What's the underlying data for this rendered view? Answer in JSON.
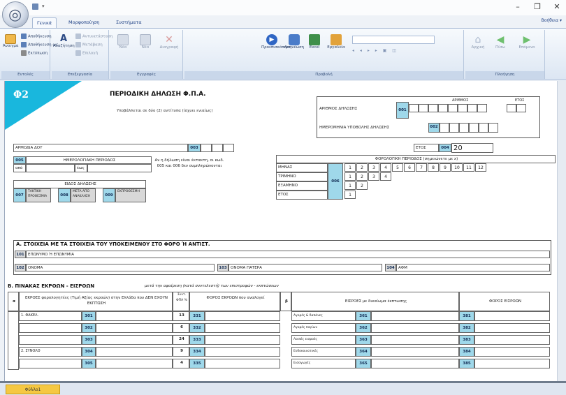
{
  "window": {
    "minimize": "–",
    "maximize": "❐",
    "close": "✕"
  },
  "ribbon_tabs": [
    "Γενικά",
    "Μορφοποίηση",
    "Συστήματα"
  ],
  "help_text": "Βοήθεια ▾",
  "ribbon": {
    "groups": [
      {
        "label": "Εντολές",
        "buttons": [
          "Άνοιγμα"
        ],
        "small": [
          "Αποθήκευση",
          "Αποθήκευση ως",
          "Εκτύπωση"
        ]
      },
      {
        "label": "Επεξεργασία",
        "buttons": [
          "Αναζήτηση"
        ],
        "small": [
          "Αντικατάσταση",
          "Μετάβαση",
          "Επιλογή"
        ]
      },
      {
        "label": "Εγγραφές",
        "buttons": [
          "Νέα",
          "Νέο",
          "Διαγραφή"
        ]
      },
      {
        "label": "Προβολή",
        "buttons": [
          "Προεπισκόπηση",
          "Ανανέωση",
          "Excel",
          "Εργαλεία"
        ]
      },
      {
        "label": "Πλοήγηση",
        "buttons": [
          "Αρχική",
          "Πίσω",
          "Επόμενο"
        ]
      }
    ]
  },
  "form": {
    "symbol": "Φ2",
    "title": "ΠΕΡΙΟΔΙΚΗ ΔΗΛΩΣΗ Φ.Π.Α.",
    "subtitle": "Υποβάλλεται σε δύο (2) αντίτυπα (ίσχυει ενιαίως)",
    "decl_number_label": "ΑΡΙΘΜΟΣ ΔΗΛΩΣΗΣ",
    "code_001": "001",
    "arithmos_hdr": "ΑΡΙΘΜΟΣ",
    "etos_hdr": "ΕΤΟΣ",
    "prev_decl_label": "ΗΜΕΡΟΜΗΝΙΑ ΥΠΟΒΟΛΗΣ ΔΗΛΩΣΗΣ",
    "code_002": "002",
    "doy_label": "ΑΡΜΟΔΙΑ ΔΟΥ",
    "code_003": "003",
    "period_code": "005",
    "period_label": "ΗΜΕΡΟΛΟΓΙΑΚΗ ΠΕΡΙΟΔΟΣ",
    "apo": "από",
    "eos": "έως",
    "note": "Αν η δήλωση είναι έκτακτη, οι κωδ. 005 και 006 δεν συμπληρώνονται",
    "year_label": "ΕΤΟΣ",
    "code_004": "004",
    "year_value": "20",
    "tax_period_label": "ΦΟΡΟΛΟΓΙΚΗ ΠΕΡΙΟΔΟΣ (σημειώνετε με x)",
    "code_006": "006",
    "period_rows": [
      {
        "label": "ΜΗΝΑΣ",
        "nums": [
          "1",
          "2",
          "3",
          "4",
          "5",
          "6",
          "7",
          "8",
          "9",
          "10",
          "11",
          "12"
        ]
      },
      {
        "label": "ΤΡΙΜΗΝΟ",
        "nums": [
          "1",
          "2",
          "3",
          "4"
        ]
      },
      {
        "label": "ΕΞΑΜΗΝΟ",
        "nums": [
          "1",
          "2"
        ]
      },
      {
        "label": "ΕΤΟΣ",
        "nums": [
          "1"
        ]
      }
    ],
    "decl_type_label": "ΕΙΔΟΣ ΔΗΛΩΣΗΣ",
    "decl_types": [
      {
        "code": "007",
        "label": "ΤΑΚΤΙΚΗ ΠΡΟΘΕΣΜΙΑ"
      },
      {
        "code": "008",
        "label": "ΜΕΤΑ ΑΠΟ ΑΝΑΚΛΗΣΗ"
      },
      {
        "code": "009",
        "label": "ΕΚΠΡΟΘΕΣΜΗ"
      }
    ],
    "sectionA": "Α. ΣΤΟΙΧΕΙΑ ΜΕ ΤΑ ΣΤΟΙΧΕΙΑ ΤΟΥ ΥΠΟΚΕΙΜΕΝΟΥ ΣΤΟ ΦΟΡΟ Ή ΑΝΤΙΣΤ.",
    "a_rows": [
      {
        "code": "101",
        "label": "ΕΠΩΝΥΜΟ Ή ΕΠΩΝΥΜΙΑ"
      },
      {
        "code": "102",
        "label": "ΟΝΟΜΑ"
      },
      {
        "code": "103",
        "label": "ΟΝΟΜΑ ΠΑΤΕΡΑ"
      },
      {
        "code": "104",
        "label": "ΑΦΜ"
      }
    ],
    "sectionB": "Β. ΠΙΝΑΚΑΣ ΕΚΡΟΩΝ - ΕΙΣΡΟΩΝ",
    "sectionB_sub": "μετά την αφαίρεση (κατά συντελεστή) των επιστροφών - εκπτώσεων",
    "col_a": "α",
    "col_b": "β",
    "col_a_hdr": "ΕΚΡΟΕΣ φορολογητέες (Τιμή Αξίας εκροών) στην Ελλάδα που ΔΕΝ ΕΧΟΥΝ ΕΚΠΤΩΣΗ",
    "col_rate_hdr": "Συντ. ΦΠΑ %",
    "col_vat_hdr": "ΦΟΡΟΣ ΕΚΡΟΩΝ που αναλογεί",
    "col_b_hdr": "ΕΙΣΡΟΕΣ με δικαίωμα έκπτωσης",
    "col_vat_in_hdr": "ΦΟΡΟΣ ΕΙΣΡΟΩΝ",
    "rows": [
      {
        "left": "1. ΦΑΚΕΛ.",
        "code": "301",
        "rate": "13",
        "vcode": "331",
        "rlabel": "Αγορές & δαπάνες",
        "icode": "361",
        "tcode": "381"
      },
      {
        "left": "",
        "code": "302",
        "rate": "6",
        "vcode": "332",
        "rlabel": "Αγορές παγίων",
        "icode": "362",
        "tcode": "382"
      },
      {
        "left": "",
        "code": "303",
        "rate": "24",
        "vcode": "333",
        "rlabel": "Λοιπές εισροές",
        "icode": "363",
        "tcode": "383"
      },
      {
        "left": "2. ΣΥΝΟΛΟ",
        "code": "304",
        "rate": "9",
        "vcode": "334",
        "rlabel": "Ενδοκοινοτικές",
        "icode": "364",
        "tcode": "384"
      },
      {
        "left": "",
        "code": "305",
        "rate": "4",
        "vcode": "335",
        "rlabel": "Εισαγωγές",
        "icode": "365",
        "tcode": "385"
      }
    ]
  },
  "sheet_tab": "Φύλλο1"
}
